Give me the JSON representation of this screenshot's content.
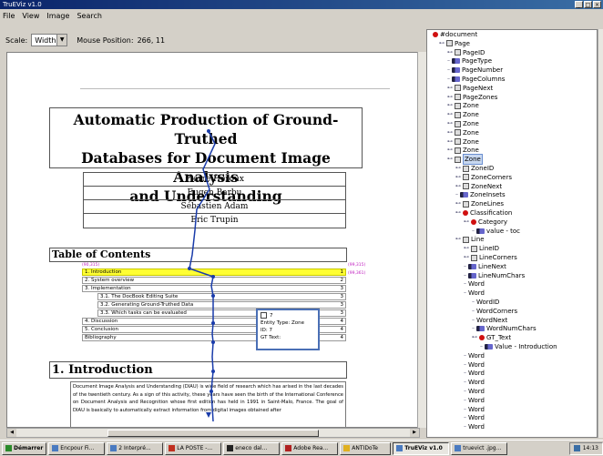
{
  "window": {
    "title": "TruEViz v1.0"
  },
  "menu": [
    "File",
    "View",
    "Image",
    "Search"
  ],
  "toolbar": {
    "scale_label": "Scale:",
    "scale_value": "Width",
    "mouse_label": "Mouse Position:",
    "mouse_value": "266, 11"
  },
  "document": {
    "title_lines": [
      "Automatic Production of Ground-Truthed",
      "Databases for Document Image Analysis",
      "and Understanding"
    ],
    "authors": [
      "Pierre Héroux",
      "Eugen Barbu",
      "Sébastien Adam",
      "Eric Trupin"
    ],
    "toc_title": "Table of Contents",
    "toc": [
      {
        "label": "1. Introduction",
        "page": "1"
      },
      {
        "label": "2. System overview",
        "page": "2"
      },
      {
        "label": "3. Implementation",
        "page": "3"
      },
      {
        "label": "3.1. The DocBook Editing Suite",
        "page": "3"
      },
      {
        "label": "3.2. Generating Ground-Truthed Data",
        "page": "3"
      },
      {
        "label": "3.3. Which tasks can be evaluated",
        "page": "3"
      },
      {
        "label": "4. Discussion",
        "page": "4"
      },
      {
        "label": "5. Conclusion",
        "page": "4"
      },
      {
        "label": "Bibliography",
        "page": "4"
      }
    ],
    "coords": {
      "left": "(90,315)",
      "right_top": "(99,315)",
      "right_bottom": "(99,361)"
    },
    "section_title": "1. Introduction",
    "paragraph": "Document Image Analysis and Understanding (DIAU) is wide field of research which has arised in the last decades of the twentieth century. As a sign of this activity, these years have seen the birth of the International Conference on Document Analysis and Recognition whose first edition has held in 1991 in Saint-Malo, France. The goal of DIAU is basically to automatically extract information from digital images obtained after"
  },
  "tooltip": {
    "title": "7",
    "entity": "Entity Type: Zone",
    "id": "ID: 7",
    "gt": "GT Text:"
  },
  "tree": [
    {
      "label": "#document",
      "icon": "red"
    },
    {
      "label": "Page",
      "icon": "el"
    },
    {
      "label": "PageID",
      "icon": "el"
    },
    {
      "label": "PageType",
      "icon": "attr"
    },
    {
      "label": "PageNumber",
      "icon": "attr"
    },
    {
      "label": "PageColumns",
      "icon": "attr"
    },
    {
      "label": "PageNext",
      "icon": "el"
    },
    {
      "label": "PageZones",
      "icon": "el"
    },
    {
      "label": "Zone",
      "icon": "el"
    },
    {
      "label": "Zone",
      "icon": "el"
    },
    {
      "label": "Zone",
      "icon": "el"
    },
    {
      "label": "Zone",
      "icon": "el"
    },
    {
      "label": "Zone",
      "icon": "el"
    },
    {
      "label": "Zone",
      "icon": "el"
    },
    {
      "label": "Zone",
      "icon": "el"
    },
    {
      "label": "ZoneID",
      "icon": "el"
    },
    {
      "label": "ZoneCorners",
      "icon": "el"
    },
    {
      "label": "ZoneNext",
      "icon": "el"
    },
    {
      "label": "ZoneInsets",
      "icon": "attr"
    },
    {
      "label": "ZoneLines",
      "icon": "el"
    },
    {
      "label": "Classification",
      "icon": "red"
    },
    {
      "label": "Category",
      "icon": "red"
    },
    {
      "label": "value - toc",
      "icon": "attr"
    },
    {
      "label": "Line",
      "icon": "el"
    },
    {
      "label": "LineID",
      "icon": "el"
    },
    {
      "label": "LineCorners",
      "icon": "el"
    },
    {
      "label": "LineNext",
      "icon": "attr"
    },
    {
      "label": "LineNumChars",
      "icon": "attr"
    },
    {
      "label": "Word",
      "icon": "none"
    },
    {
      "label": "Word",
      "icon": "none"
    },
    {
      "label": "WordID",
      "icon": "none"
    },
    {
      "label": "WordCorners",
      "icon": "none"
    },
    {
      "label": "WordNext",
      "icon": "none"
    },
    {
      "label": "WordNumChars",
      "icon": "attr"
    },
    {
      "label": "GT_Text",
      "icon": "red"
    },
    {
      "label": "Value - Introduction",
      "icon": "attr"
    },
    {
      "label": "Word",
      "icon": "none"
    },
    {
      "label": "Word",
      "icon": "none"
    },
    {
      "label": "Word",
      "icon": "none"
    },
    {
      "label": "Word",
      "icon": "none"
    },
    {
      "label": "Word",
      "icon": "none"
    },
    {
      "label": "Word",
      "icon": "none"
    },
    {
      "label": "Word",
      "icon": "none"
    },
    {
      "label": "Word",
      "icon": "none"
    },
    {
      "label": "Word",
      "icon": "none"
    }
  ],
  "taskbar": {
    "start": "Démarrer",
    "items": [
      "Encpour Fi...",
      "2 Interpré...",
      "LA POSTE -...",
      "eneco dal...",
      "Adobe Rea...",
      "ANTIDoTe",
      "TruEViz v1.0",
      "truevict .jpg..."
    ],
    "clock": "14:13"
  },
  "colors": {
    "highlight": "#ffff33",
    "accent": "#4a6fb5",
    "title_bar": "#0a246a"
  }
}
